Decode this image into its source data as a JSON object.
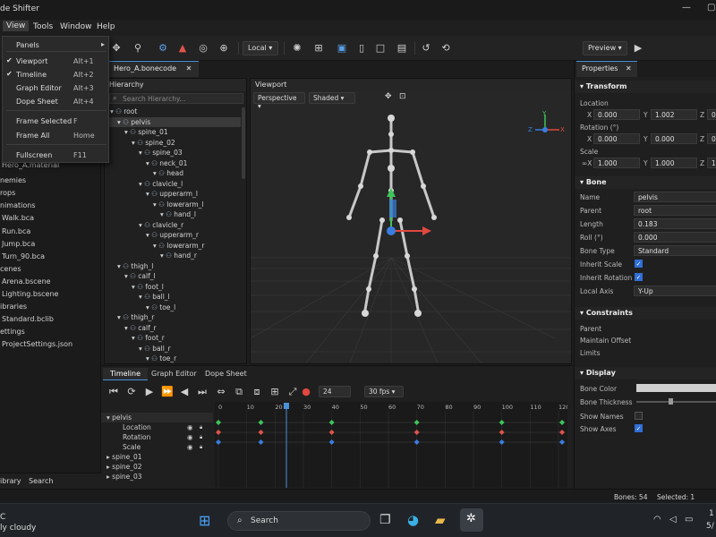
{
  "window": {
    "title": "de Shifter"
  },
  "menubar": {
    "items": [
      "View",
      "Tools",
      "Window",
      "Help"
    ]
  },
  "view_menu": {
    "items": [
      {
        "label": "Panels",
        "shortcut": "",
        "checked": false,
        "submenu": true
      },
      {
        "label": "Viewport",
        "shortcut": "Alt+1",
        "checked": true
      },
      {
        "label": "Timeline",
        "shortcut": "Alt+2",
        "checked": true
      },
      {
        "label": "Graph Editor",
        "shortcut": "Alt+3",
        "checked": false
      },
      {
        "label": "Dope Sheet",
        "shortcut": "Alt+4",
        "checked": false
      },
      {
        "label": "Frame Selected",
        "shortcut": "F",
        "checked": false
      },
      {
        "label": "Frame All",
        "shortcut": "Home",
        "checked": false
      },
      {
        "label": "Fullscreen",
        "shortcut": "F11",
        "checked": false
      }
    ]
  },
  "toolbar": {
    "space": "Local",
    "preview": "Preview"
  },
  "assets": {
    "rows": [
      "Hero_A.material",
      "nemies",
      "rops",
      "nimations",
      "Walk.bca",
      "Run.bca",
      "Jump.bca",
      "Turn_90.bca",
      "cenes",
      "Arena.bscene",
      "Lighting.bscene",
      "ibraries",
      "Standard.bclib",
      "ettings",
      "ProjectSettings.json"
    ],
    "tabs": [
      "ibrary",
      "Search"
    ]
  },
  "document": {
    "tab": "Hero_A.bonecode"
  },
  "hierarchy": {
    "title": "Hierarchy",
    "search_placeholder": "Search Hierarchy...",
    "rows": [
      {
        "name": "root",
        "depth": 0
      },
      {
        "name": "pelvis",
        "depth": 1
      },
      {
        "name": "spine_01",
        "depth": 2
      },
      {
        "name": "spine_02",
        "depth": 3
      },
      {
        "name": "spine_03",
        "depth": 4
      },
      {
        "name": "neck_01",
        "depth": 5
      },
      {
        "name": "head",
        "depth": 6
      },
      {
        "name": "clavicle_l",
        "depth": 4
      },
      {
        "name": "upperarm_l",
        "depth": 5
      },
      {
        "name": "lowerarm_l",
        "depth": 6
      },
      {
        "name": "hand_l",
        "depth": 7
      },
      {
        "name": "clavicle_r",
        "depth": 4
      },
      {
        "name": "upperarm_r",
        "depth": 5
      },
      {
        "name": "lowerarm_r",
        "depth": 6
      },
      {
        "name": "hand_r",
        "depth": 7
      },
      {
        "name": "thigh_l",
        "depth": 1
      },
      {
        "name": "calf_l",
        "depth": 2
      },
      {
        "name": "foot_l",
        "depth": 3
      },
      {
        "name": "ball_l",
        "depth": 4
      },
      {
        "name": "toe_l",
        "depth": 5
      },
      {
        "name": "thigh_r",
        "depth": 1
      },
      {
        "name": "calf_r",
        "depth": 2
      },
      {
        "name": "foot_r",
        "depth": 3
      },
      {
        "name": "ball_r",
        "depth": 4
      },
      {
        "name": "toe_r",
        "depth": 5
      }
    ]
  },
  "viewport": {
    "title": "Viewport",
    "projection": "Perspective",
    "shading": "Shaded"
  },
  "timeline": {
    "tabs": [
      "Timeline",
      "Graph Editor",
      "Dope Sheet"
    ],
    "frame": "24",
    "fps": "30 fps",
    "ruler": [
      "0",
      "10",
      "20",
      "30",
      "40",
      "50",
      "60",
      "70",
      "80",
      "90",
      "100",
      "110",
      "120"
    ],
    "tracks": [
      {
        "name": "pelvis",
        "group": true
      },
      {
        "name": "Location",
        "group": false
      },
      {
        "name": "Rotation",
        "group": false
      },
      {
        "name": "Scale",
        "group": false
      },
      {
        "name": "spine_01",
        "group": true
      },
      {
        "name": "spine_02",
        "group": true
      },
      {
        "name": "spine_03",
        "group": true
      }
    ],
    "keys_location": [
      0,
      15,
      40,
      70,
      100,
      125
    ],
    "keys_rotation": [
      0,
      15,
      40,
      70,
      100,
      125
    ],
    "keys_scale": [
      0,
      15,
      40,
      70,
      100,
      125
    ],
    "playhead": 24,
    "key_colors": {
      "location": "#3ec45a",
      "rotation": "#e0534a",
      "scale": "#3a7de0"
    }
  },
  "properties": {
    "title": "Properties",
    "transform": {
      "title": "Transform",
      "location_label": "Location",
      "location": [
        "0.000",
        "1.002",
        "0."
      ],
      "rotation_label": "Rotation (°)",
      "rotation": [
        "0.000",
        "0.000",
        "0."
      ],
      "scale_label": "Scale",
      "scale": [
        "1.000",
        "1.000",
        "1."
      ]
    },
    "bone": {
      "title": "Bone",
      "name_label": "Name",
      "name": "pelvis",
      "parent_label": "Parent",
      "parent": "root",
      "length_label": "Length",
      "length": "0.183",
      "roll_label": "Roll (°)",
      "roll": "0.000",
      "type_label": "Bone Type",
      "type": "Standard",
      "inherit_scale_label": "Inherit Scale",
      "inherit_rotation_label": "Inherit Rotation",
      "local_axis_label": "Local Axis",
      "local_axis": "Y-Up"
    },
    "constraints": {
      "title": "Constraints",
      "parent": "Parent",
      "maintain_offset": "Maintain Offset",
      "limits": "Limits"
    },
    "display": {
      "title": "Display",
      "bone_color": "Bone Color",
      "bone_thickness": "Bone Thickness",
      "show_names": "Show Names",
      "show_axes": "Show Axes"
    }
  },
  "status": {
    "bones": "Bones: 54",
    "selected": "Selected: 1"
  },
  "taskbar": {
    "weather_temp": "C",
    "weather": "ly cloudy",
    "search": "Search",
    "time": "1",
    "date": "5/"
  },
  "colors": {
    "accent": "#4a90d9",
    "axis_x": "#e0483e",
    "axis_y": "#3ec45a",
    "axis_z": "#3a7de0"
  }
}
